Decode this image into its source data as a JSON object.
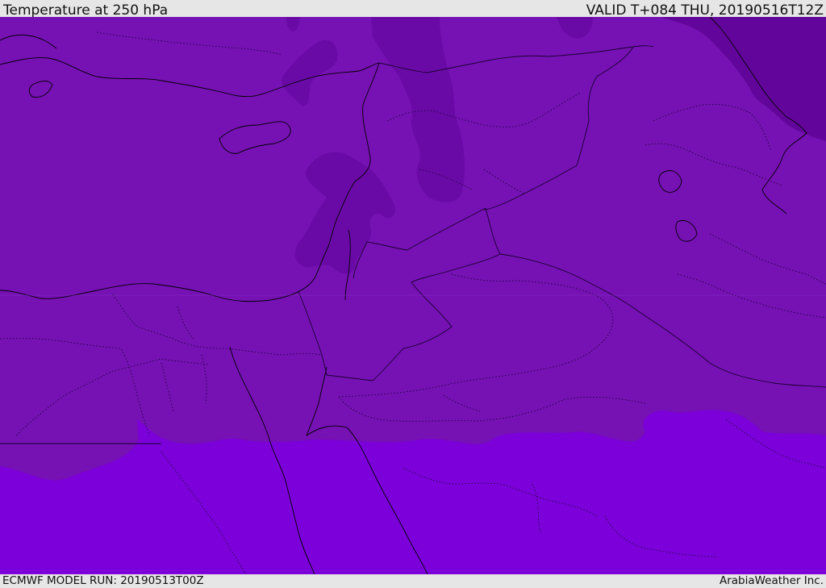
{
  "header": {
    "title": "Temperature at 250 hPa",
    "valid": "VALID T+084 THU, 20190516T12Z"
  },
  "footer": {
    "model_run": "ECMWF MODEL RUN: 20190513T00Z",
    "credit": "ArabiaWeather Inc."
  },
  "map": {
    "field": "temperature",
    "level": "250 hPa",
    "colors": {
      "warm_band": "#7b00d9",
      "mid_band": "#7611b4",
      "cold_band": "#6a0aa6",
      "coldest_band": "#62069b",
      "coastline": "#000000",
      "border": "#1a0030"
    }
  }
}
